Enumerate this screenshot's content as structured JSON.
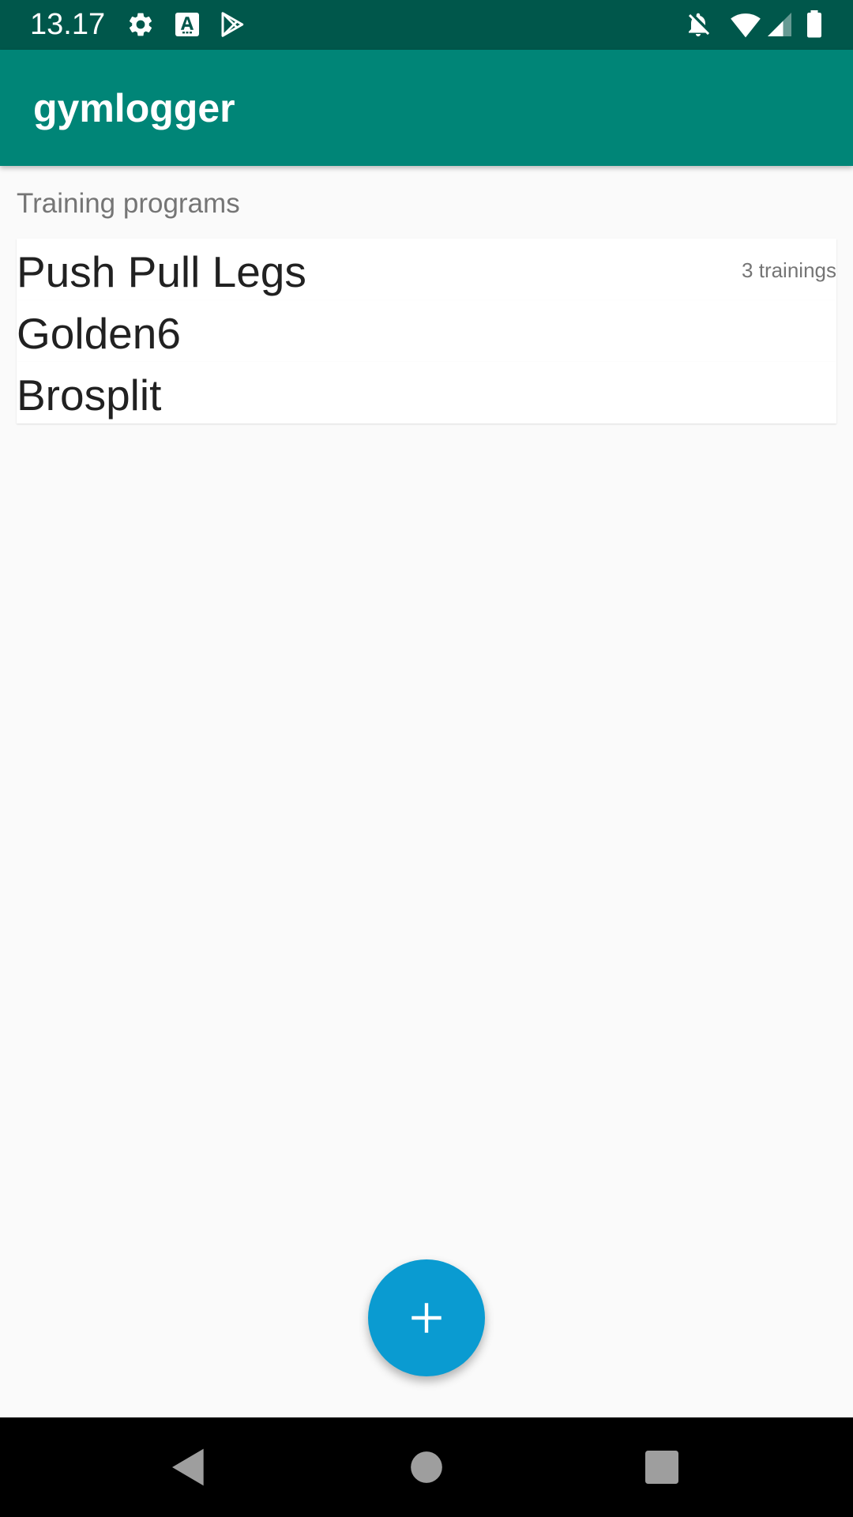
{
  "status_bar": {
    "time": "13.17",
    "left_icons": [
      "gear-icon",
      "accessibility-a-icon",
      "play-store-icon"
    ],
    "right_icons": [
      "notifications-off-icon",
      "wifi-icon",
      "signal-icon",
      "battery-icon"
    ]
  },
  "app_bar": {
    "title": "gymlogger"
  },
  "section": {
    "header": "Training programs"
  },
  "programs": [
    {
      "name": "Push Pull Legs",
      "count": "3 trainings"
    },
    {
      "name": "Golden6",
      "count": ""
    },
    {
      "name": "Brosplit",
      "count": ""
    }
  ],
  "fab": {
    "icon": "plus-icon"
  },
  "nav_bar": {
    "icons": [
      "back-icon",
      "home-icon",
      "recents-icon"
    ]
  },
  "colors": {
    "status_bar": "#00574b",
    "app_bar": "#008577",
    "fab": "#0a9bd1",
    "background": "#fafafa"
  }
}
